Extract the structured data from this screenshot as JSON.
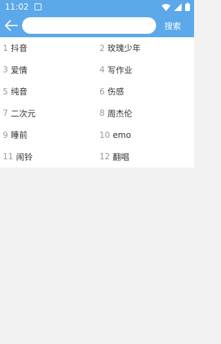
{
  "status": {
    "time": "11:02"
  },
  "search": {
    "placeholder": "",
    "button_label": "搜索"
  },
  "hot_items": [
    {
      "index": "1",
      "text": "抖音"
    },
    {
      "index": "2",
      "text": "玫瑰少年"
    },
    {
      "index": "3",
      "text": "爱情"
    },
    {
      "index": "4",
      "text": "写作业"
    },
    {
      "index": "5",
      "text": "纯音"
    },
    {
      "index": "6",
      "text": "伤感"
    },
    {
      "index": "7",
      "text": "二次元"
    },
    {
      "index": "8",
      "text": "周杰伦"
    },
    {
      "index": "9",
      "text": "睡前"
    },
    {
      "index": "10",
      "text": "emo"
    },
    {
      "index": "11",
      "text": "闹铃"
    },
    {
      "index": "12",
      "text": "翻唱"
    }
  ],
  "colors": {
    "accent": "#5ba8ea",
    "background": "#f2f2f2",
    "index_text": "#999999",
    "item_text": "#333333"
  }
}
